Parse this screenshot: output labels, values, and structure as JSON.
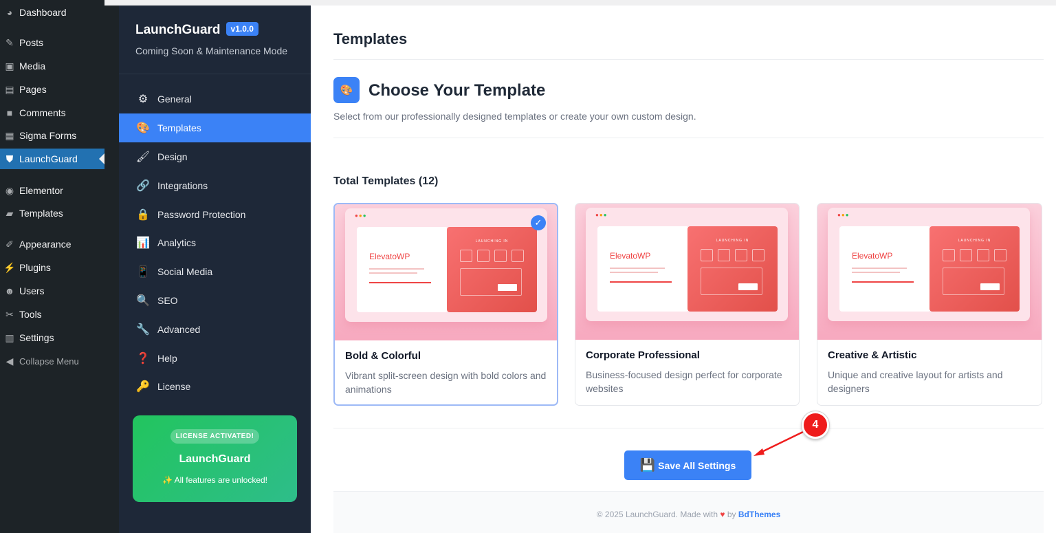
{
  "wp_menu": {
    "items": [
      {
        "label": "Dashboard",
        "icon": "dashboard-icon"
      },
      {
        "label": "Posts",
        "icon": "pin-icon"
      },
      {
        "label": "Media",
        "icon": "media-icon"
      },
      {
        "label": "Pages",
        "icon": "page-icon"
      },
      {
        "label": "Comments",
        "icon": "comment-icon"
      },
      {
        "label": "Sigma Forms",
        "icon": "form-icon"
      },
      {
        "label": "LaunchGuard",
        "icon": "shield-icon",
        "active": true
      },
      {
        "label": "Elementor",
        "icon": "elementor-icon"
      },
      {
        "label": "Templates",
        "icon": "folder-icon"
      },
      {
        "label": "Appearance",
        "icon": "brush-icon"
      },
      {
        "label": "Plugins",
        "icon": "plug-icon"
      },
      {
        "label": "Users",
        "icon": "user-icon"
      },
      {
        "label": "Tools",
        "icon": "wrench-icon"
      },
      {
        "label": "Settings",
        "icon": "settings-icon"
      },
      {
        "label": "Collapse Menu",
        "icon": "collapse-icon"
      }
    ]
  },
  "plugin": {
    "name": "LaunchGuard",
    "version": "v1.0.0",
    "subtitle": "Coming Soon & Maintenance Mode",
    "nav": [
      {
        "label": "General",
        "icon": "gear-icon"
      },
      {
        "label": "Templates",
        "icon": "palette-icon",
        "active": true
      },
      {
        "label": "Design",
        "icon": "paintbrush-icon"
      },
      {
        "label": "Integrations",
        "icon": "link-icon"
      },
      {
        "label": "Password Protection",
        "icon": "lock-icon"
      },
      {
        "label": "Analytics",
        "icon": "bar-chart-icon"
      },
      {
        "label": "Social Media",
        "icon": "phone-icon"
      },
      {
        "label": "SEO",
        "icon": "magnifier-icon"
      },
      {
        "label": "Advanced",
        "icon": "wrench-icon"
      },
      {
        "label": "Help",
        "icon": "question-icon"
      },
      {
        "label": "License",
        "icon": "key-icon"
      }
    ],
    "license": {
      "badge": "LICENSE ACTIVATED!",
      "name": "LaunchGuard",
      "message": "✨ All features are unlocked!"
    }
  },
  "main": {
    "page_title": "Templates",
    "section_title": "Choose Your Template",
    "section_subtitle": "Select from our professionally designed templates or create your own custom design.",
    "total_label": "Total Templates (12)",
    "templates": [
      {
        "title": "Bold & Colorful",
        "description": "Vibrant split-screen design with bold colors and animations",
        "selected": true,
        "preview_logo": "ElevatoWP",
        "preview_heading": "LAUNCHING IN"
      },
      {
        "title": "Corporate Professional",
        "description": "Business-focused design perfect for corporate websites",
        "selected": false,
        "preview_logo": "ElevatoWP",
        "preview_heading": "LAUNCHING IN"
      },
      {
        "title": "Creative & Artistic",
        "description": "Unique and creative layout for artists and designers",
        "selected": false,
        "preview_logo": "ElevatoWP",
        "preview_heading": "LAUNCHING IN"
      }
    ],
    "save_label": "Save All Settings",
    "footer_prefix": "© 2025 LaunchGuard. Made with",
    "footer_by": "by",
    "footer_brand": "BdThemes"
  },
  "annotation": {
    "step": "4"
  },
  "colors": {
    "accent": "#3b82f6",
    "wp_active": "#2271b1",
    "license_green": "#22c55e",
    "annotation_red": "#ef1c1c"
  }
}
